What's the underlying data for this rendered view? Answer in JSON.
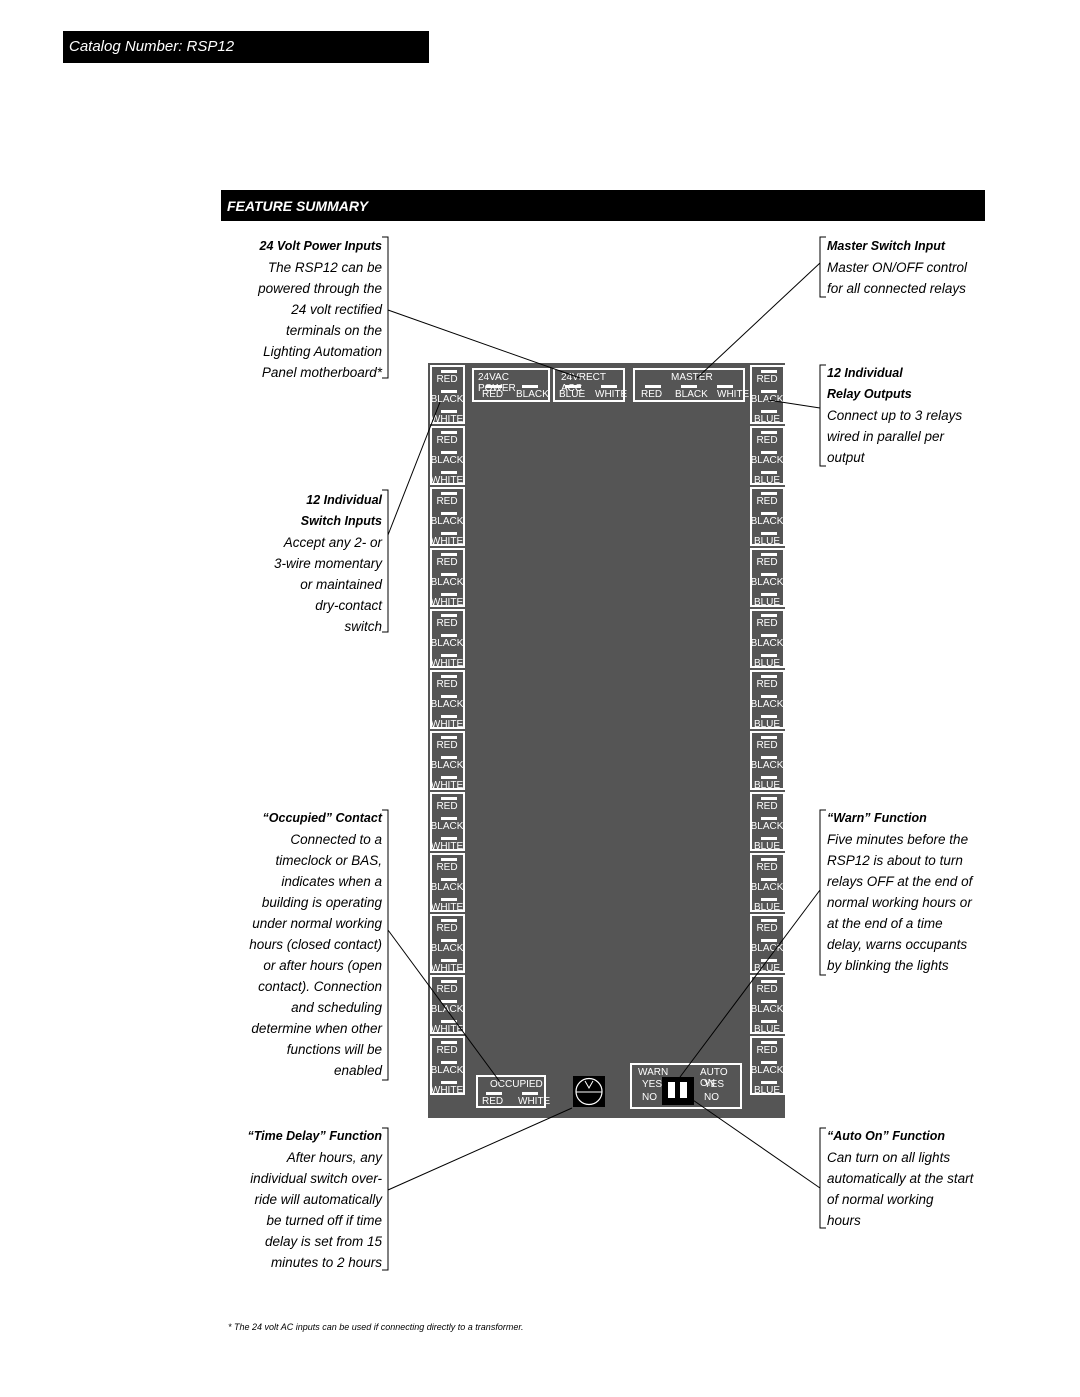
{
  "catalog": "Catalog Number: RSP12",
  "feature_summary": "FEATURE SUMMARY",
  "notes": {
    "power": {
      "title": "24 Volt Power Inputs",
      "body": [
        "The RSP12 can be",
        "powered through the",
        "24 volt rectified",
        "terminals on the",
        "Lighting Automation",
        "Panel motherboard*"
      ]
    },
    "switch": {
      "title": [
        "12 Individual",
        "Switch Inputs"
      ],
      "body": [
        "Accept any 2- or",
        "3-wire momentary",
        "or maintained",
        "dry-contact",
        "switch"
      ]
    },
    "occupied": {
      "title": "“Occupied” Contact",
      "body": [
        "Connected to a",
        "timeclock or BAS,",
        "indicates when a",
        "building is operating",
        "under normal working",
        "hours (closed contact)",
        "or after hours (open",
        "contact). Connection",
        "and scheduling",
        "determine when other",
        "functions will be",
        "enabled"
      ]
    },
    "timedelay": {
      "title": "“Time Delay” Function",
      "body": [
        "After hours, any",
        "individual switch over-",
        "ride will automatically",
        "be turned off if time",
        "delay is set from 15",
        "minutes to 2 hours"
      ]
    },
    "master": {
      "title": "Master Switch Input",
      "body": [
        "Master ON/OFF control",
        "for all connected relays"
      ]
    },
    "relay": {
      "title": [
        "12 Individual",
        "Relay Outputs"
      ],
      "body": [
        "Connect up to 3 relays",
        "wired in parallel per",
        "output"
      ]
    },
    "warn": {
      "title": "“Warn” Function",
      "body": [
        "Five minutes before the",
        "RSP12 is about to turn",
        "relays OFF at the end of",
        "normal working hours or",
        "at the end of a time",
        "delay, warns occupants",
        "by blinking the lights"
      ]
    },
    "autoon": {
      "title": "“Auto On” Function",
      "body": [
        "Can turn on all lights",
        "automatically at the start",
        "of normal working",
        "hours"
      ]
    }
  },
  "board": {
    "left_terminals": [
      "RED",
      "BLACK",
      "WHITE"
    ],
    "right_terminals": [
      "RED",
      "BLACK",
      "BLUE"
    ],
    "block_count": 12,
    "power": {
      "label": "24VAC POWER",
      "terms": [
        "RED",
        "BLACK"
      ]
    },
    "rect": {
      "label": "24VRECT ACC",
      "terms": [
        "BLUE",
        "WHITE"
      ]
    },
    "master": {
      "label": "MASTER",
      "terms": [
        "RED",
        "BLACK",
        "WHITE"
      ]
    },
    "occupied": {
      "label": "OCCUPIED",
      "terms": [
        "RED",
        "WHITE"
      ]
    },
    "dip": {
      "warn": "WARN",
      "auto_on": "AUTO ON",
      "yes": "YES",
      "no": "NO"
    }
  },
  "footnote": "* The 24 volt AC inputs can be used if connecting directly to a transformer."
}
